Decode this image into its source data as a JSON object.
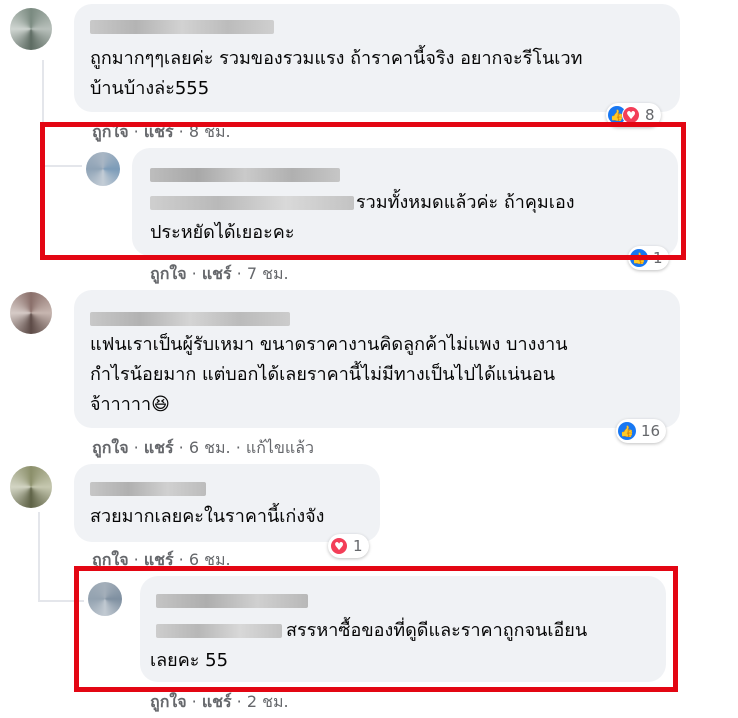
{
  "comments": [
    {
      "text": "ถูกมากๆๆเลยค่ะ รวมของรวมแรง ถ้าราคานี้จริง อยากจะรีโนเวท\nบ้านบ้างล่ะ555",
      "like": "ถูกใจ",
      "share": "แชร์",
      "time": "8 ชม.",
      "reaction_count": "8"
    },
    {
      "text": "รวมทั้งหมดแล้วค่ะ ถ้าคุมเอง\nประหยัดได้เยอะคะ",
      "like": "ถูกใจ",
      "share": "แชร์",
      "time": "7 ชม.",
      "reaction_count": "1"
    },
    {
      "text": "แฟนเราเป็นผู้รับเหมา ขนาดราคางานคิดลูกค้าไม่แพง บางงาน\nกำไรน้อยมาก แต่บอกได้เลยราคานี้ไม่มีทางเป็นไปได้แน่นอน\nจ้าาาาา😆",
      "like": "ถูกใจ",
      "share": "แชร์",
      "time": "6 ชม.",
      "edited": "แก้ไขแล้ว",
      "reaction_count": "16"
    },
    {
      "text": "สวยมากเลยคะในราคานี้เก่งจัง",
      "like": "ถูกใจ",
      "share": "แชร์",
      "time": "6 ชม.",
      "reaction_count": "1"
    },
    {
      "text": "สรรหาซื้อของที่ดูดีและราคาถูกจนเอียน\nเลยคะ 55",
      "like": "ถูกใจ",
      "share": "แชร์",
      "time": "2 ชม."
    }
  ],
  "colors": {
    "highlight": "#e30613",
    "bubble": "#f0f2f5",
    "like_blue": "#1877f2",
    "love_red": "#f33e58"
  }
}
